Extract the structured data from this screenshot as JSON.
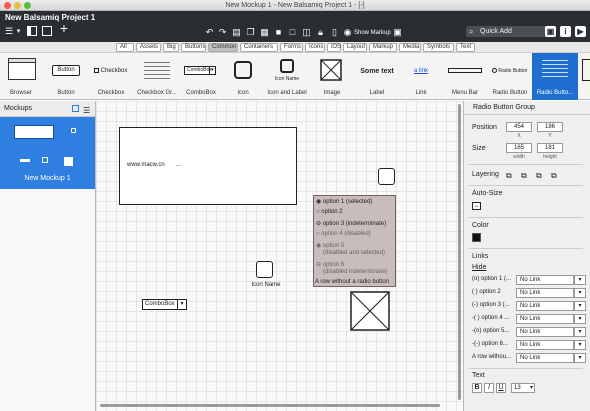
{
  "window": {
    "title": "New Mockup 1 - New Balsamiq Project 1 - [-]"
  },
  "app": {
    "project_title": "New Balsamiq Project 1",
    "show_markup_label": "Show Markup",
    "quick_add_placeholder": "Quick Add"
  },
  "categories": [
    "All",
    "Assets",
    "Big",
    "Buttons",
    "Common",
    "Containers",
    "Forms",
    "Icons",
    "iOS",
    "Layout",
    "Markup",
    "Media",
    "Symbols",
    "Text"
  ],
  "selected_category": "Common",
  "library": [
    {
      "label": "Browser"
    },
    {
      "label": "Button",
      "preview": "Button"
    },
    {
      "label": "Checkbox",
      "preview": "Checkbox"
    },
    {
      "label": "Checkbox Gr..."
    },
    {
      "label": "ComboBox",
      "preview": "ComboBox"
    },
    {
      "label": "Icon"
    },
    {
      "label": "Icon and Label",
      "preview": "Icon Name"
    },
    {
      "label": "Image"
    },
    {
      "label": "Label",
      "preview": "Some text"
    },
    {
      "label": "Link",
      "preview": "a link"
    },
    {
      "label": "Menu Bar"
    },
    {
      "label": "Radio Button",
      "preview": "Radio Button"
    },
    {
      "label": "Radio Butto..."
    }
  ],
  "left_panel": {
    "header": "Mockups",
    "mockups": [
      {
        "name": "New Mockup 1"
      }
    ]
  },
  "canvas": {
    "browser_text": "www.macw.cn",
    "browser_ellipsis": "...",
    "icon_name": "Icon Name",
    "combobox_label": "ComboBox",
    "radio_group": {
      "items": [
        {
          "text": "option 1 (selected)",
          "state": "selected"
        },
        {
          "text": "option 2",
          "state": "normal"
        },
        {
          "text": "option 3 (indeterminate)",
          "state": "indeterminate"
        },
        {
          "text": "option 4 (disabled)",
          "state": "disabled"
        },
        {
          "text": "option 5",
          "text2": "(disabled and selected)",
          "state": "disabled-selected"
        },
        {
          "text": "option 6",
          "text2": "(disabled indeterminate)",
          "state": "disabled-indeterminate"
        },
        {
          "text": "A row without a radio button",
          "state": "none"
        }
      ]
    }
  },
  "properties": {
    "title": "Radio Button Group",
    "position_label": "Position",
    "position_x": "454",
    "position_y": "186",
    "x_label": "X",
    "y_label": "Y",
    "size_label": "Size",
    "size_w": "165",
    "size_h": "181",
    "width_label": "width",
    "height_label": "height",
    "layering_label": "Layering",
    "autosize_label": "Auto-Size",
    "color_label": "Color",
    "color_value": "#111111",
    "links_label": "Links",
    "hide_label": "Hide",
    "links": [
      {
        "label": "(o) option 1 (...",
        "value": "No Link"
      },
      {
        "label": "( ) option 2",
        "value": "No Link"
      },
      {
        "label": "(-) option 3 (...",
        "value": "No Link"
      },
      {
        "label": "-( ) option 4 ...",
        "value": "No Link"
      },
      {
        "label": "-(o) option 5...",
        "value": "No Link"
      },
      {
        "label": "-(-) option 6...",
        "value": "No Link"
      },
      {
        "label": "A row withou...",
        "value": "No Link"
      }
    ],
    "text_label": "Text",
    "font_size": "13",
    "bold_label": "B",
    "italic_label": "I",
    "underline_label": "U"
  }
}
